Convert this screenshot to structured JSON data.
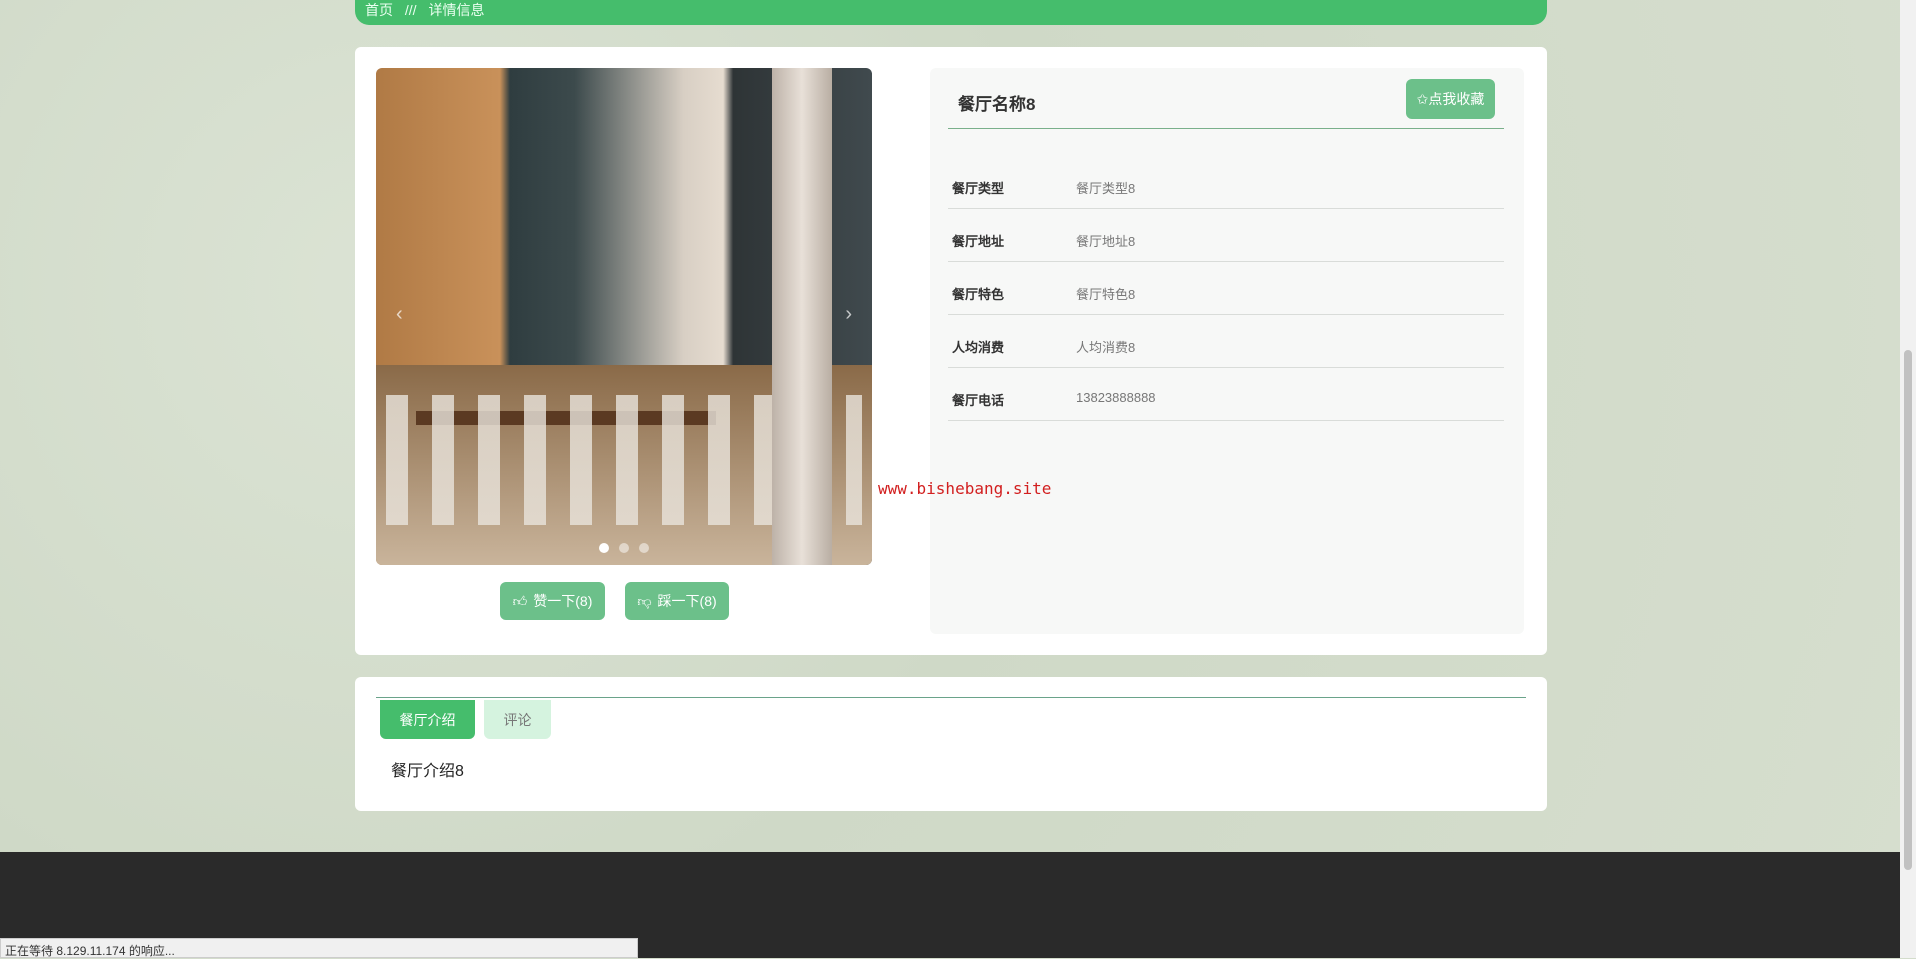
{
  "breadcrumb": {
    "home": "首页",
    "sep": "///",
    "current": "详情信息"
  },
  "detail": {
    "name": "餐厅名称8",
    "favorite": "✩点我收藏",
    "fields": [
      {
        "label": "餐厅类型",
        "value": "餐厅类型8"
      },
      {
        "label": "餐厅地址",
        "value": "餐厅地址8"
      },
      {
        "label": "餐厅特色",
        "value": "餐厅特色8"
      },
      {
        "label": "人均消费",
        "value": "人均消费8"
      },
      {
        "label": "餐厅电话",
        "value": "13823888888"
      }
    ]
  },
  "actions": {
    "like": "赞一下(8)",
    "dislike": "踩一下(8)"
  },
  "watermark": "www.bishebang.site",
  "tabs": [
    {
      "label": "餐厅介绍"
    },
    {
      "label": "评论"
    }
  ],
  "intro": "餐厅介绍8",
  "status": "正在等待 8.129.11.174 的响应..."
}
